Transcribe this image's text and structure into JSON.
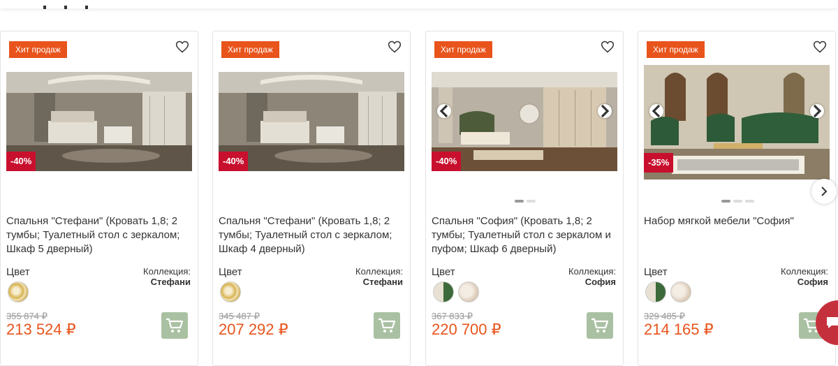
{
  "colors": {
    "accent": "#e8541c",
    "discount": "#c8102e",
    "cart": "#a9c1a2",
    "chat": "#c5303d"
  },
  "products": [
    {
      "badge": "Хит продаж",
      "discount": "-40%",
      "title": "Спальня \"Стефани\" (Кровать 1,8; 2 тумбы; Туалетный стол с зеркалом; Шкаф 5 дверный)",
      "color_label": "Цвет",
      "collection_label": "Коллекция:",
      "collection": "Стефани",
      "old_price": "355 874 ₽",
      "price": "213 524 ₽",
      "icons": {
        "favorite": "heart-icon",
        "cart": "cart-icon"
      }
    },
    {
      "badge": "Хит продаж",
      "discount": "-40%",
      "title": "Спальня \"Стефани\" (Кровать 1,8; 2 тумбы; Туалетный стол с зеркалом; Шкаф 4 дверный)",
      "color_label": "Цвет",
      "collection_label": "Коллекция:",
      "collection": "Стефани",
      "old_price": "345 487 ₽",
      "price": "207 292 ₽",
      "icons": {
        "favorite": "heart-icon",
        "cart": "cart-icon"
      }
    },
    {
      "badge": "Хит продаж",
      "discount": "-40%",
      "title": "Спальня \"София\" (Кровать 1,8; 2 тумбы; Туалетный стол с зеркалом и пуфом; Шкаф 6 дверный)",
      "color_label": "Цвет",
      "collection_label": "Коллекция:",
      "collection": "София",
      "old_price": "367 833 ₽",
      "price": "220 700 ₽",
      "icons": {
        "favorite": "heart-icon",
        "cart": "cart-icon"
      }
    },
    {
      "badge": "Хит продаж",
      "discount": "-35%",
      "title": "Набор мягкой мебели \"София\"",
      "color_label": "Цвет",
      "collection_label": "Коллекция:",
      "collection": "София",
      "old_price": "329 485 ₽",
      "price": "214 165 ₽",
      "icons": {
        "favorite": "heart-icon",
        "cart": "cart-icon"
      }
    }
  ]
}
